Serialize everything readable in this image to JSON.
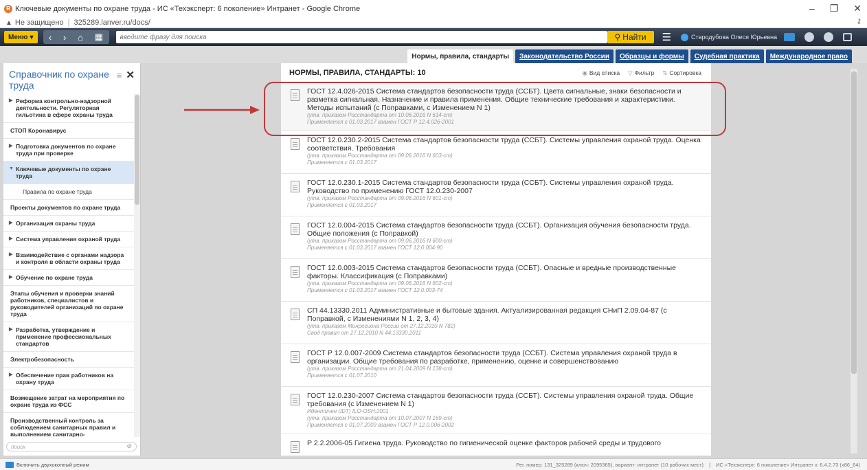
{
  "window": {
    "title": "Ключевые документы по охране труда - ИС «Техэксперт: 6 поколение» Интранет - Google Chrome",
    "controls": [
      "–",
      "❐",
      "✕"
    ]
  },
  "address": {
    "security": "Не защищено",
    "url": "325289.lanver.ru/docs/"
  },
  "toolbar": {
    "menu_label": "Меню",
    "search_placeholder": "введите фразу для поиска",
    "find_label": "Найти",
    "user": "Стародубова Олеся Юрьевна"
  },
  "tabs": [
    {
      "label": "Нормы, правила, стандарты",
      "active": true
    },
    {
      "label": "Законодательство России",
      "active": false
    },
    {
      "label": "Образцы и формы",
      "active": false
    },
    {
      "label": "Судебная практика",
      "active": false
    },
    {
      "label": "Международное право",
      "active": false
    }
  ],
  "sidebar": {
    "title": "Справочник по охране труда",
    "search_placeholder": "поиск",
    "items": [
      {
        "label": "Реформа контрольно-надзорной деятельности. Регуляторная гильотина в сфере охраны труда",
        "arrow": true
      },
      {
        "label": "СТОП Коронавирус",
        "arrow": false
      },
      {
        "label": "Подготовка документов по охране труда при проверке",
        "arrow": true
      },
      {
        "label": "Ключевые документы по охране труда",
        "arrow": true,
        "active": true
      },
      {
        "label": "Правила по охране труда",
        "sub": true
      },
      {
        "label": "Проекты документов по охране труда",
        "arrow": false
      },
      {
        "label": "Организация охраны труда",
        "arrow": true
      },
      {
        "label": "Система управления охраной труда",
        "arrow": true
      },
      {
        "label": "Взаимодействие с органами надзора и контроля в области охраны труда",
        "arrow": true
      },
      {
        "label": "Обучение по охране труда",
        "arrow": true
      },
      {
        "label": "Этапы обучения и проверки знаний работников, специалистов и руководителей организаций по охране труда",
        "arrow": false
      },
      {
        "label": "Разработка, утверждение и применение профессиональных стандартов",
        "arrow": true
      },
      {
        "label": "Электробезопасность",
        "arrow": false
      },
      {
        "label": "Обеспечение прав работников на охрану труда",
        "arrow": true
      },
      {
        "label": "Возмещение затрат на мероприятия по охране труда из ФСС",
        "arrow": false
      },
      {
        "label": "Производственный контроль за соблюдением санитарных правил и выполнением санитарно-",
        "arrow": false
      }
    ]
  },
  "main": {
    "title": "НОРМЫ, ПРАВИЛА, СТАНДАРТЫ: 10",
    "actions": {
      "list_view": "Вид списка",
      "filter": "Фильтр",
      "sort": "Сортировка"
    },
    "documents": [
      {
        "title": "ГОСТ 12.4.026-2015 Система стандартов безопасности труда (ССБТ). Цвета сигнальные, знаки безопасности и разметка сигнальная. Назначение и правила применения. Общие технические требования и характеристики. Методы испытаний (с Поправками, с Изменением N 1)",
        "meta1": "(утв. приказом Росстандарта от 10.06.2016 N 614-ст)",
        "meta2": "Применяется с 01.03.2017 взамен ГОСТ Р 12.4.026-2001"
      },
      {
        "title": "ГОСТ 12.0.230.2-2015 Система стандартов безопасности труда (ССБТ). Системы управления охраной труда. Оценка соответствия. Требования",
        "meta1": "(утв. приказом Росстандарта от 09.06.2016 N 603-ст)",
        "meta2": "Применяется с 01.03.2017"
      },
      {
        "title": "ГОСТ 12.0.230.1-2015 Система стандартов безопасности труда (ССБТ). Системы управления охраной труда. Руководство по применению ГОСТ 12.0.230-2007",
        "meta1": "(утв. приказом Росстандарта от 09.06.2016 N 601-ст)",
        "meta2": "Применяется с 01.03.2017"
      },
      {
        "title": "ГОСТ 12.0.004-2015 Система стандартов безопасности труда (ССБТ). Организация обучения безопасности труда. Общие положения (с Поправкой)",
        "meta1": "(утв. приказом Росстандарта от 09.06.2016 N 600-ст)",
        "meta2": "Применяется с 01.03.2017 взамен ГОСТ 12.0.004-90"
      },
      {
        "title": "ГОСТ 12.0.003-2015 Система стандартов безопасности труда (ССБТ). Опасные и вредные производственные факторы. Классификация (с Поправками)",
        "meta1": "(утв. приказом Росстандарта от 09.06.2016 N 602-ст)",
        "meta2": "Применяется с 01.03.2017 взамен ГОСТ 12.0.003-74"
      },
      {
        "title": "СП 44.13330.2011 Административные и бытовые здания. Актуализированная редакция СНиП 2.09.04-87 (с Поправкой, с Изменениями N 1, 2, 3, 4)",
        "meta1": "(утв. приказом Минрегиона России от 27.12.2010 N 782)",
        "meta2": "Свод правил от 27.12.2010 N 44.13330.2011"
      },
      {
        "title": "ГОСТ Р 12.0.007-2009 Система стандартов безопасности труда (ССБТ). Система управления охраной труда в организации. Общие требования по разработке, применению, оценке и совершенствованию",
        "meta1": "(утв. приказом Росстандарта от 21.04.2009 N 138-ст)",
        "meta2": "Применяется с 01.07.2010"
      },
      {
        "title": "ГОСТ 12.0.230-2007 Система стандартов безопасности труда (ССБТ). Системы управления охраной труда. Общие требования (с Изменением N 1)",
        "meta0": "Идентичен (IDT) ILO-OSH:2001",
        "meta1": "(утв. приказом Росстандарта от 10.07.2007 N 169-ст)",
        "meta2": "Применяется с 01.07.2009 взамен ГОСТ Р 12.0.006-2002"
      },
      {
        "title": "Р 2.2.2006-05 Гигиена труда. Руководство по гигиенической оценке факторов рабочей среды и трудового",
        "meta1": "",
        "meta2": ""
      }
    ]
  },
  "statusbar": {
    "two_mode": "Включить двухоконный режим",
    "reg": "Рег. номер: 131_325289 (ключ: 2095365), вариант: интранет (10 рабочих мест)",
    "product": "ИС «Техэксперт: 6 поколение» Интранет v. 6.4.2.73 (x86_64)"
  },
  "colors": {
    "toolbar": "#2b3646",
    "accent": "#f2c200",
    "tab_blue": "#1f4e8c",
    "highlight": "#c0393b",
    "sidebar_title": "#3c6eb4"
  }
}
